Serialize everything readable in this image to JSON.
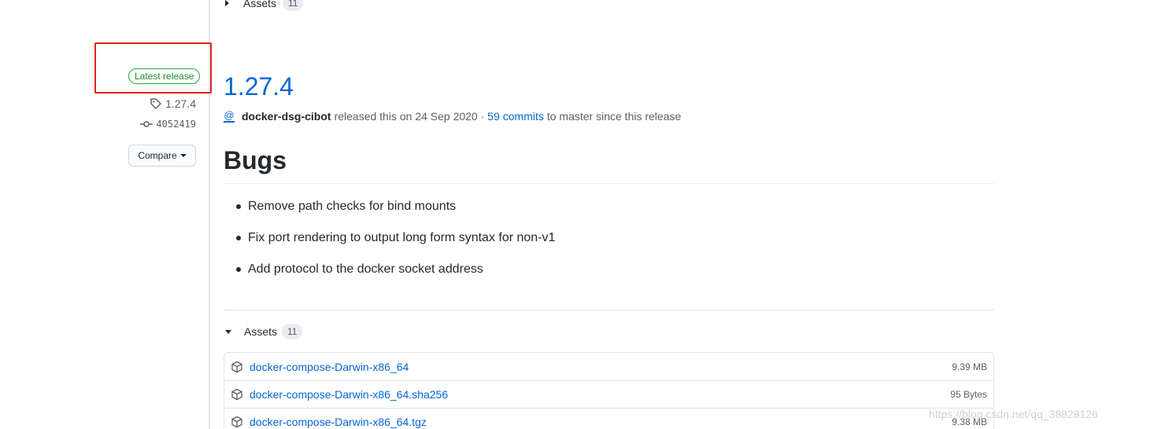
{
  "top_assets": {
    "label": "Assets",
    "count": "11"
  },
  "sidebar": {
    "badge": "Latest release",
    "tag": "1.27.4",
    "commit": "4052419",
    "compare_label": "Compare"
  },
  "release": {
    "title": "1.27.4",
    "author": "docker-dsg-cibot",
    "released_text": "released this on 24 Sep 2020 ·",
    "commits_link": "59 commits",
    "since_text": "to master since this release"
  },
  "notes": {
    "heading": "Bugs",
    "items": [
      "Remove path checks for bind mounts",
      "Fix port rendering to output long form syntax for non-v1",
      "Add protocol to the docker socket address"
    ]
  },
  "assets": {
    "label": "Assets",
    "count": "11",
    "files": [
      {
        "name": "docker-compose-Darwin-x86_64",
        "size": "9.39 MB"
      },
      {
        "name": "docker-compose-Darwin-x86_64.sha256",
        "size": "95 Bytes"
      },
      {
        "name": "docker-compose-Darwin-x86_64.tgz",
        "size": "9.38 MB"
      }
    ]
  },
  "watermark": "https://blog.csdn.net/qq_38828126",
  "colors": {
    "link": "#0366d6",
    "badge_green": "#28a745",
    "highlight_red": "#e02222"
  }
}
